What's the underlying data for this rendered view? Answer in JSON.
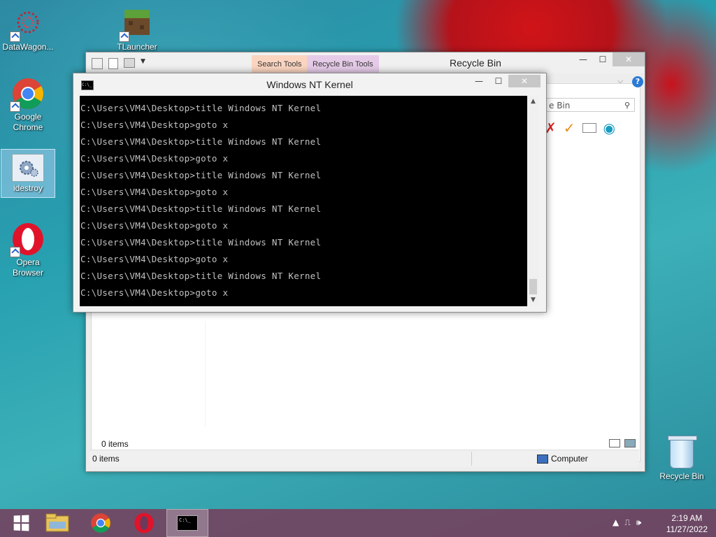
{
  "desktop": {
    "icons": [
      {
        "label": "DataWagon..."
      },
      {
        "label": "TLauncher"
      },
      {
        "label": "Google Chrome"
      },
      {
        "label": "idestroy"
      },
      {
        "label": "Opera Browser"
      },
      {
        "label": "Recycle Bin"
      }
    ]
  },
  "explorer": {
    "title": "Recycle Bin",
    "context_tabs": [
      "Search Tools",
      "Recycle Bin Tools"
    ],
    "search_text": "e Bin",
    "items_count_inner": "0 items",
    "status_items": "0 items",
    "status_location": "Computer"
  },
  "cmd": {
    "title": "Windows NT Kernel",
    "lines": [
      "C:\\Users\\VM4\\Desktop>title Windows NT Kernel",
      "C:\\Users\\VM4\\Desktop>goto x",
      "C:\\Users\\VM4\\Desktop>title Windows NT Kernel",
      "C:\\Users\\VM4\\Desktop>goto x",
      "C:\\Users\\VM4\\Desktop>title Windows NT Kernel",
      "C:\\Users\\VM4\\Desktop>goto x",
      "C:\\Users\\VM4\\Desktop>title Windows NT Kernel",
      "C:\\Users\\VM4\\Desktop>goto x",
      "C:\\Users\\VM4\\Desktop>title Windows NT Kernel",
      "C:\\Users\\VM4\\Desktop>goto x",
      "C:\\Users\\VM4\\Desktop>title Windows NT Kernel",
      "C:\\Users\\VM4\\Desktop>goto x"
    ],
    "icon_text": "C:\\_"
  },
  "taskbar": {
    "time": "2:19 AM",
    "date": "11/27/2022",
    "apps": [
      "file-explorer-icon",
      "chrome-icon",
      "opera-icon",
      "cmd-icon"
    ]
  },
  "colors": {
    "console_bg": "#000000",
    "console_fg": "#c0c0c0",
    "chrome_red": "#db4437",
    "opera_red": "#e0132b",
    "search_tab": "#fbd5c0",
    "rb_tab": "#e6cbe8"
  }
}
